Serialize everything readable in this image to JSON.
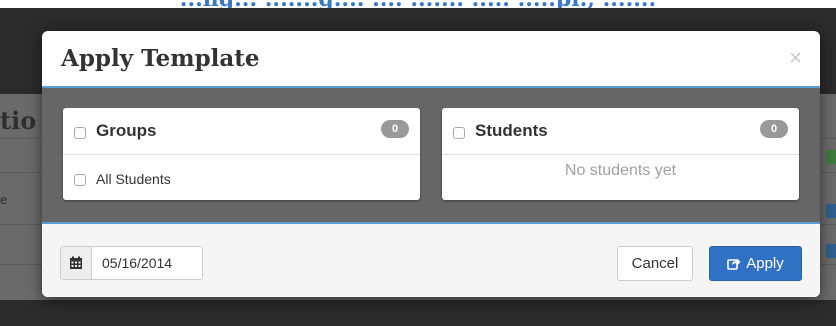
{
  "background": {
    "heading_fragment": "...ng... .......g.... .... ....... ..... .....pl., .......",
    "page_title_fragment": "tio",
    "row_label_fragment": "e"
  },
  "modal": {
    "title": "Apply Template",
    "close_label": "×",
    "groups_panel": {
      "title": "Groups",
      "count": "0",
      "items": [
        {
          "label": "All Students",
          "checked": false
        }
      ],
      "select_all_checked": false
    },
    "students_panel": {
      "title": "Students",
      "count": "0",
      "empty_text": "No students yet",
      "select_all_checked": false
    },
    "footer": {
      "date_icon": "calendar-icon",
      "date_value": "05/16/2014",
      "cancel_label": "Cancel",
      "apply_label": "Apply",
      "apply_icon": "share-icon"
    }
  },
  "colors": {
    "accent": "#5b9bd5",
    "primary_button": "#3071c4",
    "badge": "#999999",
    "overlay": "#666666"
  }
}
